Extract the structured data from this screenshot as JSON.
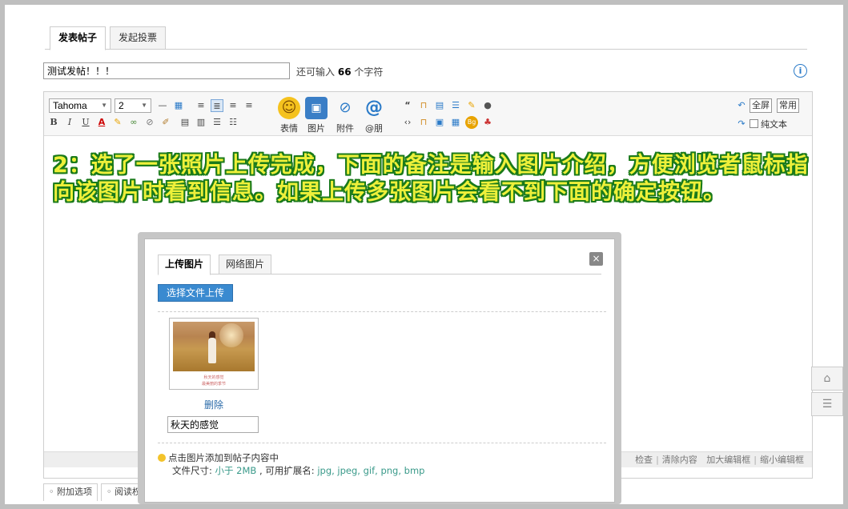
{
  "tabs": {
    "post": "发表帖子",
    "poll": "发起投票"
  },
  "subject": {
    "value": "测试发帖！！！",
    "remaining_prefix": "还可输入",
    "remaining_count": "66",
    "remaining_suffix": "个字符"
  },
  "info_icon": "i",
  "toolbar": {
    "font_name": "Tahoma",
    "font_size": "2",
    "emoticon_label": "表情",
    "image_label": "图片",
    "attach_label": "附件",
    "mention_label": "@朋",
    "fullscreen": "全屏",
    "common": "常用",
    "plaintext": "纯文本"
  },
  "statusbar": {
    "items": [
      "检查",
      "清除内容",
      "加大编辑框",
      "缩小编辑框"
    ]
  },
  "bottom_tabs": [
    "附加选项",
    "阅读权"
  ],
  "annotation": "2：选了一张照片上传完成，下面的备注是输入图片介绍，方便浏览者鼠标指向该图片时看到信息。如果上传多张图片会看不到下面的确定按钮。",
  "dialog": {
    "tab_upload": "上传图片",
    "tab_network": "网络图片",
    "close": "×",
    "upload_button": "选择文件上传",
    "delete_link": "删除",
    "description_value": "秋天的感觉",
    "photo_caption_1": "秋天的感觉",
    "photo_caption_2": "最美丽的季节",
    "tip_line1": "点击图片添加到帖子内容中",
    "tip_size_prefix": "文件尺寸: ",
    "tip_size_value": "小于 2MB",
    "tip_ext_prefix": " , 可用扩展名: ",
    "tip_ext_value": "jpg, jpeg, gif, png, bmp"
  },
  "colors": {
    "accent": "#3a8ad0",
    "annotation_fill": "#eef03a",
    "annotation_outline": "#1a7a1a"
  }
}
